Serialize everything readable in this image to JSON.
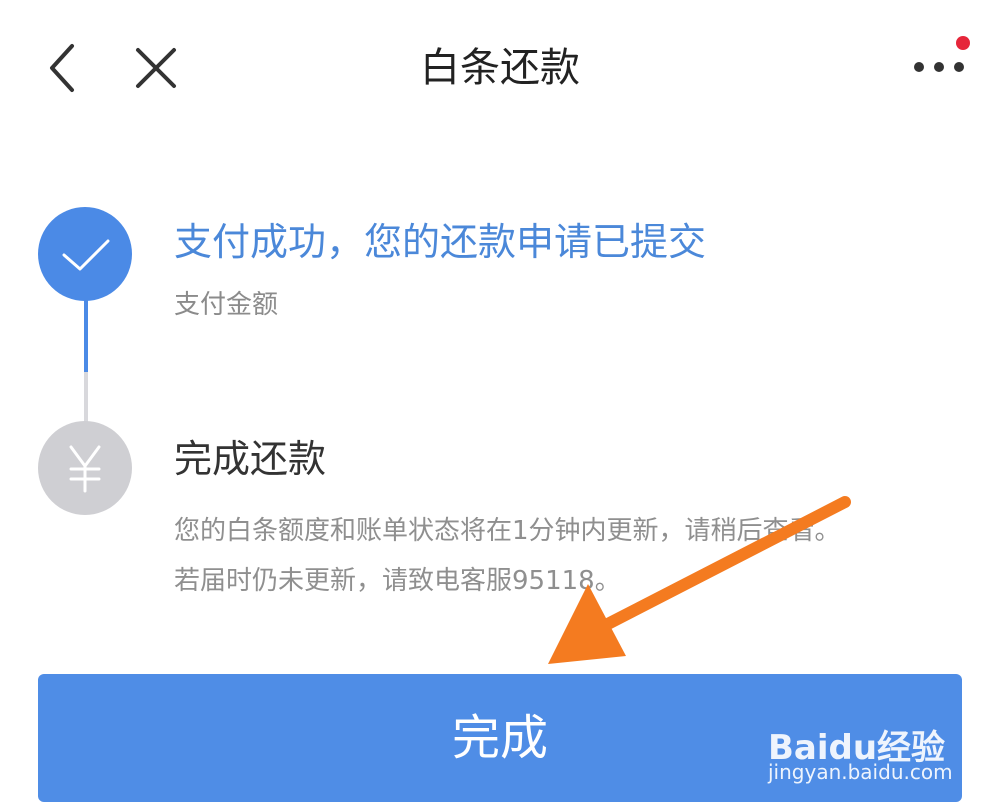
{
  "header": {
    "title": "白条还款",
    "back_icon": "chevron-left-icon",
    "close_icon": "close-icon",
    "more_icon": "more-dots-icon",
    "notification_color": "#e6263a"
  },
  "steps": [
    {
      "title": "支付成功，您的还款申请已提交",
      "subtitle": "支付金额",
      "status": "completed",
      "icon": "check-icon",
      "color": "#4b8ae6"
    },
    {
      "title": "完成还款",
      "description_lines": [
        "您的白条额度和账单状态将在1分钟内更新，请稍后查看。",
        "若届时仍未更新，请致电客服95118。"
      ],
      "status": "pending",
      "icon": "yuan-icon",
      "color": "#cfcfd3"
    }
  ],
  "done_button": {
    "label": "完成",
    "color": "#4f8de6"
  },
  "watermark": {
    "text": "Baidu经验",
    "url": "jingyan.baidu.com"
  },
  "annotation": {
    "icon": "pointer-arrow-icon",
    "color": "#f47b20"
  }
}
